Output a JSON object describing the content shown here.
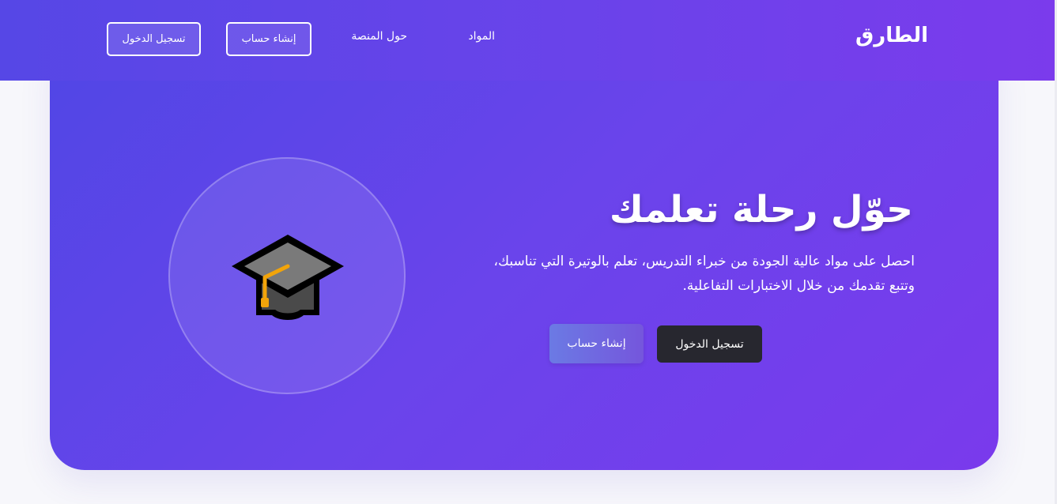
{
  "header": {
    "logo": "الطارق",
    "nav": {
      "materials": "المواد",
      "about": "حول المنصة"
    },
    "buttons": {
      "signup": "إنشاء حساب",
      "login": "تسجيل الدخول"
    }
  },
  "hero": {
    "title": "حوّل رحلة تعلمك",
    "description": "احصل على مواد عالية الجودة من خبراء التدريس، تعلم بالوتيرة التي تناسبك، وتتبع تقدمك من خلال الاختبارات التفاعلية.",
    "buttons": {
      "login": "تسجيل الدخول",
      "signup": "إنشاء حساب"
    },
    "illustration_icon": "graduation-cap-icon"
  },
  "colors": {
    "header_gradient_start": "#5647e6",
    "header_gradient_end": "#7b3bec",
    "hero_gradient_start": "#5046e5",
    "hero_gradient_end": "#7a3aec",
    "dark_button": "#27272f",
    "page_background": "#f7f7fb"
  }
}
